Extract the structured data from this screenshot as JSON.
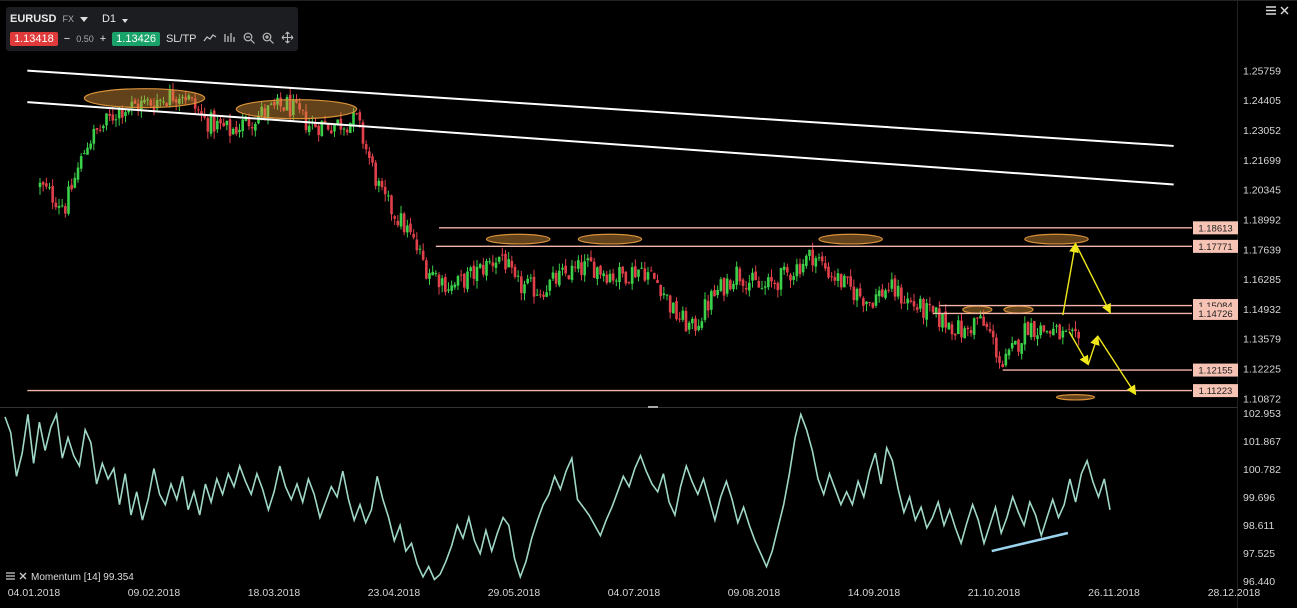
{
  "toolbar": {
    "symbol": "EURUSD",
    "market": "FX",
    "timeframe": "D1",
    "sell_price": "1.13418",
    "minus": "−",
    "spread": "0.50",
    "plus": "+",
    "buy_price": "1.13426",
    "sltp_label": "SL/TP"
  },
  "indicator": {
    "label": "Momentum [14] 99.354"
  },
  "colors": {
    "bull": "#3bd04a",
    "bear": "#e0404a",
    "trendline": "#ffffff",
    "level_line": "#f4b6a8",
    "level_label_bg": "#f6c3b4",
    "ellipse_fill": "#d9923a",
    "arrow": "#f0e81a",
    "momentum": "#9fd8c8",
    "divergence": "#9ad3ee"
  },
  "chart_data": [
    {
      "type": "candlestick",
      "symbol": "EURUSD",
      "price_axis": [
        "1.25759",
        "1.24405",
        "1.23052",
        "1.21699",
        "1.20345",
        "1.18992",
        "1.17639",
        "1.16285",
        "1.14932",
        "1.13579",
        "1.12225",
        "1.10872"
      ],
      "x_ticks": [
        "04.01.2018",
        "09.02.2018",
        "18.03.2018",
        "23.04.2018",
        "29.05.2018",
        "04.07.2018",
        "09.08.2018",
        "14.09.2018",
        "21.10.2018",
        "26.11.2018",
        "28.12.2018"
      ],
      "ylim": [
        1.1066,
        1.2664
      ],
      "price_path": [
        [
          0,
          1.205
        ],
        [
          8,
          1.196
        ],
        [
          15,
          1.225
        ],
        [
          25,
          1.24
        ],
        [
          35,
          1.243
        ],
        [
          45,
          1.248
        ],
        [
          52,
          1.235
        ],
        [
          60,
          1.23
        ],
        [
          70,
          1.238
        ],
        [
          78,
          1.242
        ],
        [
          85,
          1.233
        ],
        [
          92,
          1.233
        ],
        [
          100,
          1.235
        ],
        [
          108,
          1.2
        ],
        [
          116,
          1.185
        ],
        [
          122,
          1.168
        ],
        [
          130,
          1.159
        ],
        [
          138,
          1.166
        ],
        [
          146,
          1.174
        ],
        [
          150,
          1.16
        ],
        [
          158,
          1.158
        ],
        [
          166,
          1.165
        ],
        [
          174,
          1.169
        ],
        [
          182,
          1.164
        ],
        [
          190,
          1.168
        ],
        [
          196,
          1.16
        ],
        [
          200,
          1.148
        ],
        [
          206,
          1.14
        ],
        [
          212,
          1.154
        ],
        [
          220,
          1.166
        ],
        [
          228,
          1.158
        ],
        [
          236,
          1.165
        ],
        [
          244,
          1.174
        ],
        [
          250,
          1.165
        ],
        [
          256,
          1.158
        ],
        [
          262,
          1.153
        ],
        [
          268,
          1.159
        ],
        [
          276,
          1.151
        ],
        [
          282,
          1.146
        ],
        [
          288,
          1.142
        ],
        [
          292,
          1.138
        ],
        [
          296,
          1.145
        ],
        [
          300,
          1.138
        ],
        [
          304,
          1.123
        ],
        [
          308,
          1.132
        ],
        [
          312,
          1.142
        ],
        [
          316,
          1.14
        ],
        [
          320,
          1.139
        ],
        [
          324,
          1.136
        ],
        [
          328,
          1.134
        ]
      ],
      "trendlines": [
        {
          "from": [
            -4,
            1.2575
          ],
          "to": [
            358,
            1.2233
          ]
        },
        {
          "from": [
            -4,
            1.2432
          ],
          "to": [
            358,
            1.2058
          ]
        }
      ],
      "levels": [
        {
          "label": "1.18613",
          "value": 1.18613,
          "from": 126
        },
        {
          "label": "1.17771",
          "value": 1.17771,
          "from": 125
        },
        {
          "label": "1.15084",
          "value": 1.15084,
          "from": 284
        },
        {
          "label": "1.14726",
          "value": 1.14726,
          "from": 282
        },
        {
          "label": "1.12155",
          "value": 1.12155,
          "from": 304
        },
        {
          "label": "1.11223",
          "value": 1.11223,
          "from": -4
        }
      ],
      "highlight_ellipses": [
        {
          "x": 33,
          "y": 1.245,
          "rx": 19,
          "ry": 0.0043
        },
        {
          "x": 81,
          "y": 1.24,
          "rx": 19,
          "ry": 0.0043
        },
        {
          "x": 151,
          "y": 1.181,
          "rx": 10,
          "ry": 0.0022
        },
        {
          "x": 180,
          "y": 1.181,
          "rx": 10,
          "ry": 0.0022
        },
        {
          "x": 256,
          "y": 1.181,
          "rx": 10,
          "ry": 0.0022
        },
        {
          "x": 321,
          "y": 1.181,
          "rx": 10,
          "ry": 0.0022
        },
        {
          "x": 296,
          "y": 1.149,
          "rx": 4.6,
          "ry": 0.0016
        },
        {
          "x": 309,
          "y": 1.149,
          "rx": 4.6,
          "ry": 0.0016
        },
        {
          "x": 327,
          "y": 1.1092,
          "rx": 6,
          "ry": 0.0012
        }
      ],
      "projection_arrows": [
        [
          [
            323,
            1.1465
          ],
          [
            327,
            1.179
          ]
        ],
        [
          [
            327,
            1.179
          ],
          [
            338,
            1.1475
          ]
        ],
        [
          [
            325,
            1.139
          ],
          [
            331,
            1.124
          ]
        ],
        [
          [
            331,
            1.124
          ],
          [
            334,
            1.137
          ]
        ],
        [
          [
            334,
            1.137
          ],
          [
            346,
            1.1105
          ]
        ]
      ]
    },
    {
      "type": "line",
      "series": [
        {
          "name": "Momentum [14]",
          "last": 99.354
        }
      ],
      "y_axis": [
        "102.953",
        "101.867",
        "100.782",
        "99.696",
        "98.611",
        "97.525",
        "96.440"
      ],
      "ylim": [
        96.44,
        102.953
      ],
      "values": [
        102.8,
        102.2,
        100.5,
        101.4,
        102.9,
        101.0,
        102.6,
        101.5,
        102.4,
        102.9,
        101.2,
        102.0,
        101.3,
        100.9,
        102.3,
        101.8,
        100.2,
        101.0,
        100.4,
        100.8,
        99.4,
        100.6,
        99.0,
        99.9,
        98.8,
        99.6,
        100.8,
        99.8,
        99.4,
        100.2,
        99.6,
        100.5,
        99.2,
        99.9,
        99.0,
        100.2,
        99.5,
        100.4,
        99.8,
        100.6,
        100.1,
        100.9,
        100.3,
        99.8,
        100.6,
        100.0,
        99.2,
        99.9,
        100.9,
        100.1,
        99.6,
        100.2,
        99.5,
        100.4,
        99.8,
        98.9,
        99.5,
        100.1,
        99.7,
        100.7,
        99.6,
        98.8,
        99.4,
        98.7,
        99.2,
        100.5,
        99.6,
        98.9,
        98.0,
        98.6,
        97.6,
        97.9,
        97.1,
        96.6,
        97.0,
        96.5,
        96.7,
        97.2,
        97.8,
        98.6,
        98.1,
        98.9,
        98.0,
        97.5,
        98.4,
        97.6,
        98.3,
        98.9,
        98.6,
        97.3,
        96.6,
        97.2,
        98.1,
        98.8,
        99.4,
        99.8,
        100.5,
        100.0,
        100.7,
        101.2,
        99.6,
        99.3,
        99.0,
        98.6,
        98.2,
        98.8,
        99.3,
        99.9,
        100.5,
        100.1,
        100.8,
        101.3,
        100.7,
        100.2,
        99.9,
        100.6,
        99.5,
        99.0,
        100.1,
        100.9,
        100.3,
        99.8,
        100.4,
        99.6,
        98.8,
        99.7,
        100.3,
        99.6,
        98.7,
        99.3,
        98.6,
        98.0,
        97.5,
        97.0,
        97.6,
        98.5,
        99.4,
        100.6,
        102.0,
        102.9,
        102.3,
        101.5,
        100.4,
        99.8,
        100.6,
        100.0,
        99.4,
        99.9,
        99.4,
        100.3,
        99.7,
        100.7,
        101.4,
        100.2,
        101.6,
        101.1,
        100.0,
        99.1,
        99.7,
        98.8,
        99.3,
        98.5,
        98.9,
        99.5,
        98.6,
        99.2,
        98.5,
        97.9,
        98.7,
        99.4,
        98.8,
        97.9,
        98.6,
        99.3,
        98.3,
        98.9,
        99.7,
        99.1,
        98.6,
        99.5,
        99.0,
        98.2,
        98.9,
        99.6,
        98.9,
        99.4,
        100.4,
        99.5,
        100.6,
        101.1,
        100.3,
        99.7,
        100.4,
        99.2
      ],
      "divergence_line": [
        [
          0.66,
          97.6
        ],
        [
          0.711,
          98.3
        ]
      ]
    }
  ]
}
